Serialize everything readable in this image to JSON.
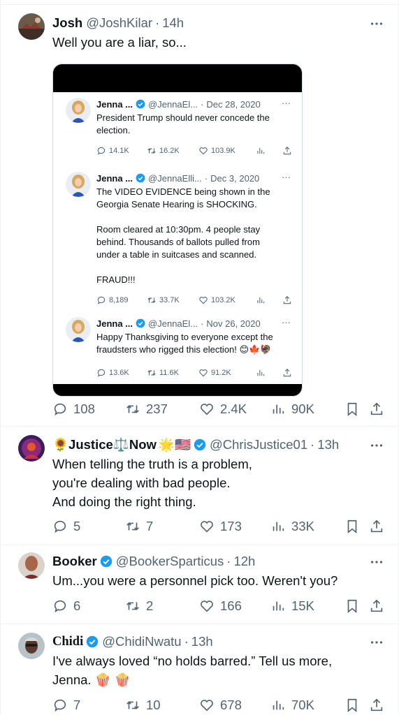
{
  "colors": {
    "text": "#0f1419",
    "muted": "#536471",
    "verified": "#1d9bf0",
    "border": "#eff3f4"
  },
  "tweets": [
    {
      "name": "Josh",
      "handle": "@JoshKilar",
      "dot": "·",
      "time": "14h",
      "lines": [
        "Well you are a liar, so..."
      ],
      "stats": {
        "reply": "108",
        "retweet": "237",
        "like": "2.4K",
        "views": "90K"
      },
      "embed": {
        "posts": [
          {
            "name": "Jenna ...",
            "handle": "@JennaEl...",
            "dot": "·",
            "date": "Dec 28, 2020",
            "more": "···",
            "lines": [
              "President Trump should never concede the",
              "election."
            ],
            "stats": {
              "reply": "14.1K",
              "retweet": "16.2K",
              "like": "103.9K"
            }
          },
          {
            "name": "Jenna ...",
            "handle": "@JennaElli...",
            "dot": "·",
            "date": "Dec 3, 2020",
            "more": "···",
            "lines": [
              "The VIDEO EVIDENCE being shown in the",
              "Georgia Senate Hearing is SHOCKING.",
              "",
              "Room cleared at 10:30pm. 4 people stay",
              "behind. Thousands of ballots pulled from",
              "under a table in suitcases and scanned.",
              "",
              "FRAUD!!!"
            ],
            "stats": {
              "reply": "8,189",
              "retweet": "33.7K",
              "like": "103.2K"
            }
          },
          {
            "name": "Jenna ...",
            "handle": "@JennaEl...",
            "dot": "·",
            "date": "Nov 26, 2020",
            "more": "···",
            "lines": [
              "Happy Thanksgiving to everyone except the",
              "fraudsters who rigged this election! 😊🍁🦃"
            ],
            "stats": {
              "reply": "13.6K",
              "retweet": "11.6K",
              "like": "91.2K"
            }
          }
        ]
      }
    },
    {
      "name_prefix": "🌻",
      "name_a": "Justice",
      "name_mid": "⚖️",
      "name_b": "Now",
      "name_suffix": "🌟🇺🇸",
      "handle": "@ChrisJustice01",
      "dot": "·",
      "time": "13h",
      "lines": [
        "When telling the truth is a problem,",
        "you're dealing with bad people.",
        "And doing the right thing."
      ],
      "stats": {
        "reply": "5",
        "retweet": "7",
        "like": "173",
        "views": "33K"
      }
    },
    {
      "name": "Booker",
      "handle": "@BookerSparticus",
      "dot": "·",
      "time": "12h",
      "lines": [
        "Um...you were a personnel pick too. Weren't you?"
      ],
      "stats": {
        "reply": "6",
        "retweet": "2",
        "like": "166",
        "views": "15K"
      }
    },
    {
      "name": "Chidi",
      "handle": "@ChidiNwatu",
      "dot": "·",
      "time": "13h",
      "lines": [
        "I've always loved “no holds barred.” Tell us more,",
        "Jenna. 🍿 🍿"
      ],
      "stats": {
        "reply": "7",
        "retweet": "10",
        "like": "678",
        "views": "70K"
      }
    }
  ]
}
